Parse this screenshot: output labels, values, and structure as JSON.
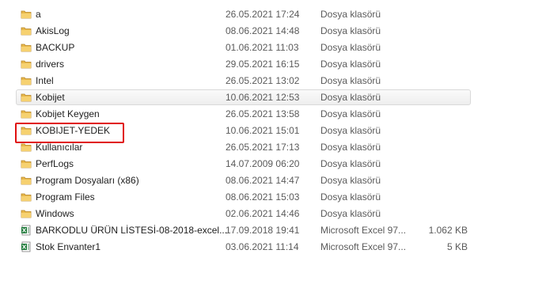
{
  "files": [
    {
      "name": "a",
      "date": "26.05.2021 17:24",
      "type": "Dosya klasörü",
      "size": "",
      "icon": "folder-icon"
    },
    {
      "name": "AkisLog",
      "date": "08.06.2021 14:48",
      "type": "Dosya klasörü",
      "size": "",
      "icon": "folder-icon"
    },
    {
      "name": "BACKUP",
      "date": "01.06.2021 11:03",
      "type": "Dosya klasörü",
      "size": "",
      "icon": "folder-icon"
    },
    {
      "name": "drivers",
      "date": "29.05.2021 16:15",
      "type": "Dosya klasörü",
      "size": "",
      "icon": "folder-icon"
    },
    {
      "name": "Intel",
      "date": "26.05.2021 13:02",
      "type": "Dosya klasörü",
      "size": "",
      "icon": "folder-icon"
    },
    {
      "name": "Kobijet",
      "date": "10.06.2021 12:53",
      "type": "Dosya klasörü",
      "size": "",
      "icon": "folder-icon",
      "selected": true
    },
    {
      "name": "Kobijet Keygen",
      "date": "26.05.2021 13:58",
      "type": "Dosya klasörü",
      "size": "",
      "icon": "folder-icon"
    },
    {
      "name": "KOBIJET-YEDEK",
      "date": "10.06.2021 15:01",
      "type": "Dosya klasörü",
      "size": "",
      "icon": "folder-icon",
      "highlighted": true
    },
    {
      "name": "Kullanıcılar",
      "date": "26.05.2021 17:13",
      "type": "Dosya klasörü",
      "size": "",
      "icon": "folder-icon"
    },
    {
      "name": "PerfLogs",
      "date": "14.07.2009 06:20",
      "type": "Dosya klasörü",
      "size": "",
      "icon": "folder-icon"
    },
    {
      "name": "Program Dosyaları (x86)",
      "date": "08.06.2021 14:47",
      "type": "Dosya klasörü",
      "size": "",
      "icon": "folder-icon"
    },
    {
      "name": "Program Files",
      "date": "08.06.2021 15:03",
      "type": "Dosya klasörü",
      "size": "",
      "icon": "folder-icon"
    },
    {
      "name": "Windows",
      "date": "02.06.2021 14:46",
      "type": "Dosya klasörü",
      "size": "",
      "icon": "folder-icon"
    },
    {
      "name": "BARKODLU ÜRÜN LİSTESİ-08-2018-excel...",
      "date": "17.09.2018 19:41",
      "type": "Microsoft Excel 97...",
      "size": "1.062 KB",
      "icon": "excel-file-icon"
    },
    {
      "name": "Stok Envanter1",
      "date": "03.06.2021 11:14",
      "type": "Microsoft Excel 97...",
      "size": "5 KB",
      "icon": "excel-file-icon"
    }
  ],
  "colors": {
    "highlight_border": "#e01010",
    "folder": "#e8b84a",
    "excel": "#1f7a3a"
  }
}
